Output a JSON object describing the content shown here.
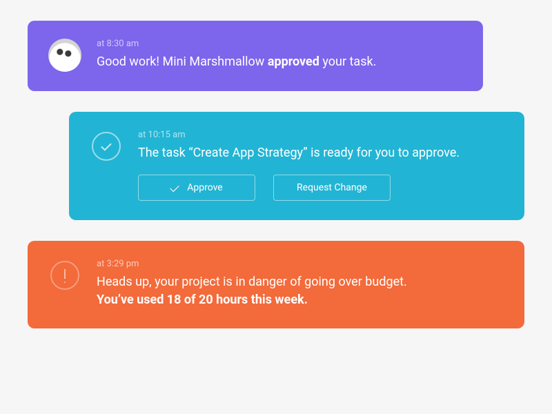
{
  "notifications": [
    {
      "timestamp": "at 8:30 am",
      "message_pre": "Good work! Mini Marshmallow ",
      "message_bold": "approved",
      "message_post": " your task.",
      "color": "#7d65ec"
    },
    {
      "timestamp": "at 10:15 am",
      "message": "The task “Create App Strategy” is ready for you to approve.",
      "approve_label": "Approve",
      "request_change_label": "Request Change",
      "color": "#22b4d4"
    },
    {
      "timestamp": "at 3:29 pm",
      "message_line1": "Heads up, your project is in danger of going over budget.",
      "message_line2": "You’ve used 18 of 20 hours this week.",
      "color": "#f36a3b"
    }
  ]
}
